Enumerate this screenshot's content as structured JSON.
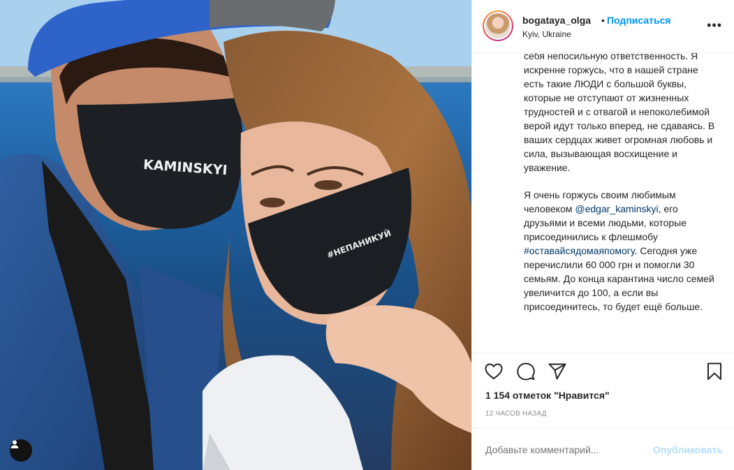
{
  "header": {
    "username": "bogataya_olga",
    "separator": "•",
    "follow_label": "Подписаться",
    "location": "Kyiv, Ukraine",
    "more_label": "•••"
  },
  "photo": {
    "mask_left_text": "KAMINSKYI",
    "mask_right_text": "#НЕПАНИКУЙ"
  },
  "caption": {
    "p1": "себя непосильную ответственность. Я искренне горжусь, что в нашей стране есть такие ЛЮДИ с большой буквы, которые не отступают от жизненных трудностей и с отвагой и непоколебимой верой идут только вперед, не сдаваясь. В ваших сердцах живет огромная любовь и сила, вызывающая восхищение и уважение.",
    "p2_a": "Я очень горжусь своим любимым человеком ",
    "p2_mention": "@edgar_kaminskyi",
    "p2_b": ", его друзьями и всеми людьми, которые присоединились к флешмобу ",
    "p2_hashtag": "#оставайсядомаяпомогу",
    "p2_c": ". Сегодня уже перечислили 60 000 грн и помогли 30 семьям. До конца карантина число семей увеличится до 100, а если вы присоединитесь, то будет ещё больше."
  },
  "actions": {
    "likes": "1 154 отметок \"Нравится\"",
    "time": "12 ЧАСОВ НАЗАД"
  },
  "comment": {
    "placeholder": "Добавьте комментарий...",
    "publish_label": "Опубликовать"
  },
  "colors": {
    "link": "#0095f6",
    "hashtag": "#00376b",
    "publish_disabled": "#b2dffc"
  }
}
